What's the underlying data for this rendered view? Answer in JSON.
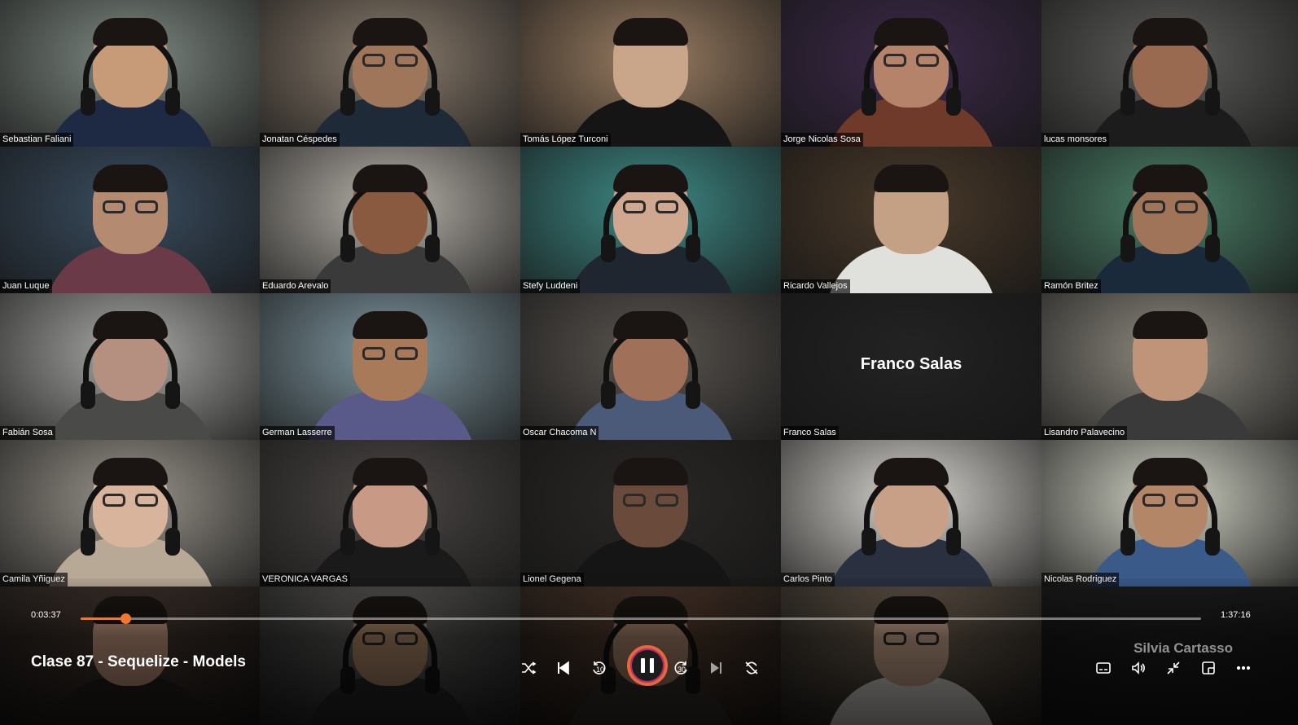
{
  "participants": [
    {
      "name": "Sebastian Faliani",
      "bg": "#7f8a83",
      "skin": "#c79a78",
      "shirt": "#1e2a44"
    },
    {
      "name": "Jonatan Céspedes",
      "bg": "#8a7c6d",
      "skin": "#a0765a",
      "shirt": "#1e2a38"
    },
    {
      "name": "Tomás López Turconi",
      "bg": "#9a7d62",
      "skin": "#c9a58a",
      "shirt": "#151515"
    },
    {
      "name": "Jorge Nicolas Sosa",
      "bg": "#3d2a4a",
      "skin": "#b5826a",
      "shirt": "#703a2a"
    },
    {
      "name": "lucas monsores",
      "bg": "#5d5e5a",
      "skin": "#9a6a50",
      "shirt": "#1c1c1c"
    },
    {
      "name": "Juan Luque",
      "bg": "#3a4d60",
      "skin": "#b48a70",
      "shirt": "#6b3a48"
    },
    {
      "name": "Eduardo Arevalo",
      "bg": "#b7b2aa",
      "skin": "#8a5a40",
      "shirt": "#3a3a3a"
    },
    {
      "name": "Stefy Luddeni",
      "bg": "#3e8a86",
      "skin": "#d0a890",
      "shirt": "#1f2630"
    },
    {
      "name": "Ricardo Vallejos",
      "bg": "#4a3a2a",
      "skin": "#c4a084",
      "shirt": "#e0e0dc"
    },
    {
      "name": "Ramón Britez",
      "bg": "#4b7f68",
      "skin": "#a07458",
      "shirt": "#1b2a3a"
    },
    {
      "name": "Fabián Sosa",
      "bg": "#a9a9a6",
      "skin": "#b59080",
      "shirt": "#4a4a48"
    },
    {
      "name": "German Lasserre",
      "bg": "#7f97a0",
      "skin": "#a87a5a",
      "shirt": "#5a5a8a"
    },
    {
      "name": "Oscar Chacoma N",
      "bg": "#5a5550",
      "skin": "#a07058",
      "shirt": "#4a5a78"
    },
    {
      "name": "Franco Salas",
      "bg": "#232323",
      "skin": "",
      "shirt": "",
      "center_label": "Franco Salas"
    },
    {
      "name": "Lisandro Palavecino",
      "bg": "#8e8a80",
      "skin": "#c09478",
      "shirt": "#3a3a3a"
    },
    {
      "name": "Camila Yñiguez",
      "bg": "#9a958c",
      "skin": "#d8b49c",
      "shirt": "#b8a896"
    },
    {
      "name": "VERONICA VARGAS",
      "bg": "#4a4644",
      "skin": "#c89a86",
      "shirt": "#1a1a1a"
    },
    {
      "name": "Lionel Gegena",
      "bg": "#2a2826",
      "skin": "#6a4a3a",
      "shirt": "#151515"
    },
    {
      "name": "Carlos Pinto",
      "bg": "#d8d6d0",
      "skin": "#c8a088",
      "shirt": "#2a3040"
    },
    {
      "name": "Nicolas Rodriguez",
      "bg": "#cfd2c4",
      "skin": "#b38668",
      "shirt": "#3a5a8a"
    },
    {
      "name": "",
      "bg": "#4a3a32",
      "skin": "#c89a80",
      "shirt": "#2a2020"
    },
    {
      "name": "",
      "bg": "#6a6866",
      "skin": "#b08a6a",
      "shirt": "#2a2a2a"
    },
    {
      "name": "",
      "bg": "#5a4030",
      "skin": "#a8846a",
      "shirt": "#3a3030"
    },
    {
      "name": "",
      "bg": "#7a6a58",
      "skin": "#d0aa90",
      "shirt": "#e8e4dc"
    },
    {
      "name": "",
      "bg": "#1e1e1e",
      "skin": "",
      "shirt": ""
    }
  ],
  "player": {
    "current_time": "0:03:37",
    "total_time": "1:37:16",
    "progress": 0.04,
    "title": "Clase 87 - Sequelize - Models",
    "watermark": "Silvia Cartasso",
    "accent": "#f0772e"
  },
  "controls": {
    "shuffle": "shuffle-icon",
    "previous": "previous-icon",
    "rewind": "10",
    "forward": "30",
    "next": "next-icon",
    "repeat": "repeat-icon",
    "subtitles": "subtitles-icon",
    "volume": "volume-icon",
    "mini": "mini-player-icon",
    "compact": "compact-overlay-icon",
    "more": "more-icon"
  }
}
